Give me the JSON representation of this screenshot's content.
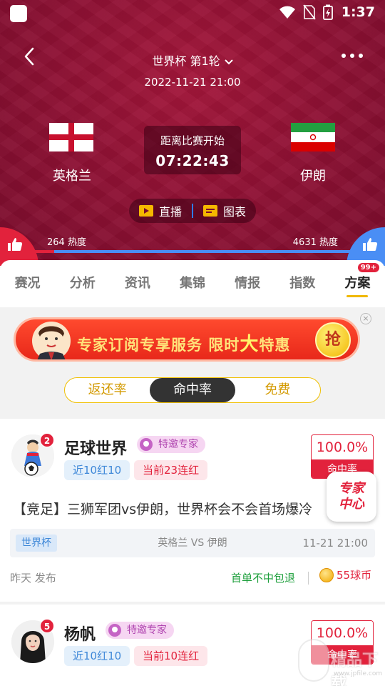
{
  "status_bar": {
    "time": "1:37"
  },
  "header": {
    "title": "世界杯 第1轮",
    "match_datetime": "2022-11-21 21:00",
    "home_team": "英格兰",
    "away_team": "伊朗",
    "countdown_label": "距离比赛开始",
    "countdown_value": "07:22:43",
    "live_label": "直播",
    "chart_label": "图表",
    "home_heat": "264 热度",
    "away_heat": "4631 热度",
    "home_heat_value": 264,
    "away_heat_value": 4631,
    "colors": {
      "home": "#e2223c",
      "away": "#4a8ef5"
    }
  },
  "tabs": [
    {
      "label": "赛况"
    },
    {
      "label": "分析"
    },
    {
      "label": "资讯"
    },
    {
      "label": "集锦"
    },
    {
      "label": "情报"
    },
    {
      "label": "指数"
    },
    {
      "label": "方案",
      "active": true,
      "badge": "99+"
    }
  ],
  "banner": {
    "text_a": "专家订阅专享服务 限时",
    "text_big": "大",
    "text_b": "特惠",
    "grab": "抢"
  },
  "segment": {
    "options": [
      "返还率",
      "命中率",
      "免费"
    ],
    "active_index": 1
  },
  "cards": [
    {
      "avatar_badge": "2",
      "name": "足球世界",
      "tag": "特邀专家",
      "stat_recent": "近10红10",
      "stat_streak": "当前23连红",
      "rate": "100.0%",
      "rate_label": "命中率",
      "pick_title": "【竞足】三狮军团vs伊朗，世界杯会不会首场爆冷",
      "competition": "世界杯",
      "match": "英格兰  VS  伊朗",
      "match_time": "11-21 21:00",
      "published": "昨天 发布",
      "refund": "首单不中包退",
      "price": "55球币"
    },
    {
      "avatar_badge": "5",
      "name": "杨帆",
      "tag": "特邀专家",
      "stat_recent": "近10红10",
      "stat_streak": "当前10连红",
      "rate": "100.0%",
      "rate_label": "命中率"
    }
  ],
  "expert_center": {
    "line1": "专家",
    "line2": "中心"
  },
  "watermark": {
    "text": "精品下载",
    "url": "www.jpfile.com"
  }
}
